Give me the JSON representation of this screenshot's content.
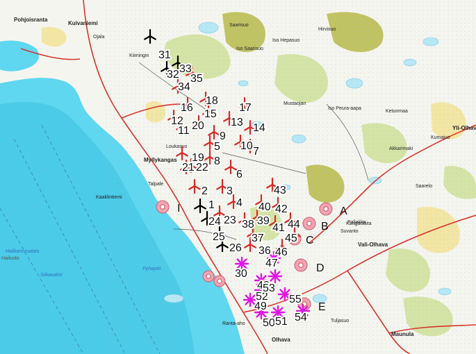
{
  "map": {
    "colors": {
      "sea": "#5fd7f0",
      "land": "#f5f5ef",
      "lake": "#b6e8f6",
      "marsh": "#d8eff6",
      "field": "#f2e397",
      "forest_green": "#cfe099",
      "olive": "#b7ba4a",
      "road": "#d8342c",
      "turbine_red": "#d52b24",
      "turbine_black": "#000000",
      "turbine_magenta": "#e313e6",
      "circle_fill": "#f3a3b1",
      "circle_stroke": "#c8616f"
    }
  },
  "place_names": [
    {
      "text": "Pohjoisranta",
      "style": "bold"
    },
    {
      "text": "Kuivaniemi",
      "style": "bold"
    },
    {
      "text": "Ojala",
      "style": "normal"
    },
    {
      "text": "Iso Saarisuo",
      "style": "normal"
    },
    {
      "text": "Iso Hepasuo",
      "style": "normal"
    },
    {
      "text": "Saarisuo",
      "style": "normal"
    },
    {
      "text": "Hirvisuo",
      "style": "normal"
    },
    {
      "text": "Iso Peura-aapa",
      "style": "normal"
    },
    {
      "text": "Yli-Olhava",
      "style": "bold"
    },
    {
      "text": "Mustaojan",
      "style": "normal"
    },
    {
      "text": "Myllykangas",
      "style": "bold"
    },
    {
      "text": "Loukasuo",
      "style": "normal"
    },
    {
      "text": "Talpale",
      "style": "normal"
    },
    {
      "text": "Kaaklintiemi",
      "style": "normal"
    },
    {
      "text": "Hailuoto",
      "style": "muted"
    },
    {
      "text": "Vali-Olhava",
      "style": "bold"
    },
    {
      "text": "Kangaslaita",
      "style": "normal"
    },
    {
      "text": "Suvanto",
      "style": "normal"
    },
    {
      "text": "Saarelo",
      "style": "normal"
    },
    {
      "text": "Pyhajoki",
      "style": "water"
    },
    {
      "text": "Siikasalmi",
      "style": "water"
    },
    {
      "text": "Halikarinmatala",
      "style": "water"
    },
    {
      "text": "Olhava",
      "style": "bold"
    },
    {
      "text": "Maunula",
      "style": "bold"
    },
    {
      "text": "Tuljasuo",
      "style": "normal"
    },
    {
      "text": "Paljakka",
      "style": "normal"
    },
    {
      "text": "Kumajuo",
      "style": "normal"
    },
    {
      "text": "Ketunmaa",
      "style": "normal"
    },
    {
      "text": "Ranta-aho",
      "style": "normal"
    },
    {
      "text": "Kiimingin",
      "style": "normal"
    },
    {
      "text": "Akkarimaki",
      "style": "normal"
    }
  ],
  "turbines": [
    {
      "id": "1",
      "color": "black"
    },
    {
      "id": "2",
      "color": "red"
    },
    {
      "id": "3",
      "color": "red"
    },
    {
      "id": "4",
      "color": "red"
    },
    {
      "id": "5",
      "color": "red"
    },
    {
      "id": "6",
      "color": "red"
    },
    {
      "id": "7",
      "color": "red"
    },
    {
      "id": "8",
      "color": "red"
    },
    {
      "id": "9",
      "color": "red"
    },
    {
      "id": "10",
      "color": "red"
    },
    {
      "id": "11",
      "color": "red"
    },
    {
      "id": "12",
      "color": "red"
    },
    {
      "id": "13",
      "color": "red"
    },
    {
      "id": "14",
      "color": "red"
    },
    {
      "id": "15",
      "color": "red"
    },
    {
      "id": "16",
      "color": "red"
    },
    {
      "id": "17",
      "color": "red"
    },
    {
      "id": "18",
      "color": "red"
    },
    {
      "id": "19",
      "color": "red"
    },
    {
      "id": "20",
      "color": "red"
    },
    {
      "id": "21",
      "color": "red"
    },
    {
      "id": "22",
      "color": "red"
    },
    {
      "id": "23",
      "color": "red"
    },
    {
      "id": "24",
      "color": "black"
    },
    {
      "id": "25",
      "color": "black"
    },
    {
      "id": "26",
      "color": "black"
    },
    {
      "id": "30",
      "color": "magenta"
    },
    {
      "id": "31",
      "color": "black"
    },
    {
      "id": "32",
      "color": "black"
    },
    {
      "id": "33",
      "color": "black"
    },
    {
      "id": "34",
      "color": "red"
    },
    {
      "id": "35",
      "color": "red"
    },
    {
      "id": "36",
      "color": "red"
    },
    {
      "id": "37",
      "color": "red"
    },
    {
      "id": "38",
      "color": "red"
    },
    {
      "id": "39",
      "color": "red"
    },
    {
      "id": "40",
      "color": "red"
    },
    {
      "id": "41",
      "color": "red"
    },
    {
      "id": "42",
      "color": "red"
    },
    {
      "id": "43",
      "color": "red"
    },
    {
      "id": "44",
      "color": "red"
    },
    {
      "id": "45",
      "color": "red"
    },
    {
      "id": "46",
      "color": "red"
    },
    {
      "id": "47",
      "color": "magenta"
    },
    {
      "id": "48",
      "color": "magenta"
    },
    {
      "id": "49",
      "color": "magenta"
    },
    {
      "id": "50",
      "color": "magenta"
    },
    {
      "id": "51",
      "color": "magenta"
    },
    {
      "id": "52",
      "color": "magenta"
    },
    {
      "id": "53",
      "color": "magenta"
    },
    {
      "id": "54",
      "color": "magenta"
    },
    {
      "id": "55",
      "color": "magenta"
    }
  ],
  "site_markers": [
    {
      "letter": "A"
    },
    {
      "letter": "B"
    },
    {
      "letter": "C"
    },
    {
      "letter": "D"
    },
    {
      "letter": "E"
    },
    {
      "letter": "I"
    }
  ]
}
